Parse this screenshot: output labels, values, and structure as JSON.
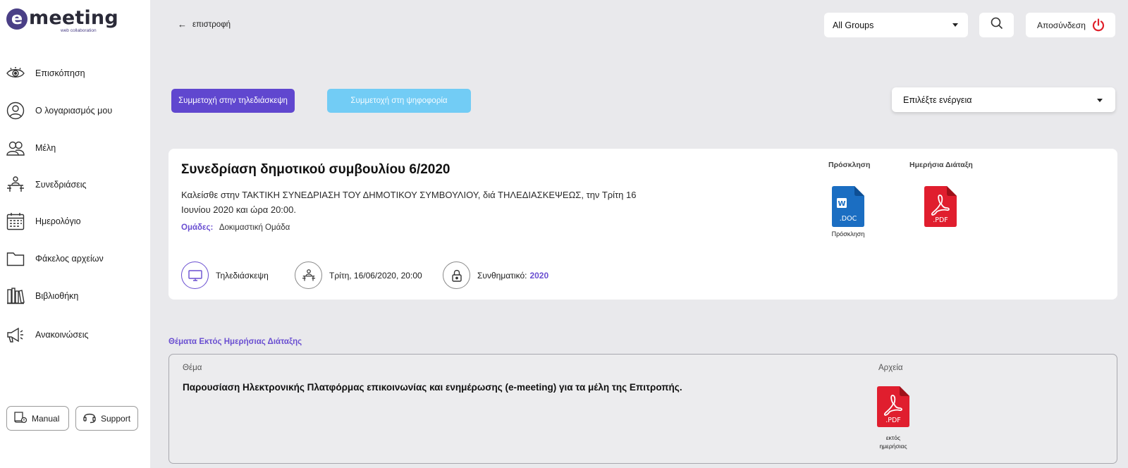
{
  "brand": {
    "name": "meeting",
    "letter": "e",
    "tagline": "web collaboration"
  },
  "sidebar": {
    "items": [
      {
        "label": "Επισκόπηση",
        "icon": "eye-icon"
      },
      {
        "label": "Ο λογαριασμός μου",
        "icon": "user-circle-icon"
      },
      {
        "label": "Μέλη",
        "icon": "users-icon"
      },
      {
        "label": "Συνεδριάσεις",
        "icon": "meeting-table-icon"
      },
      {
        "label": "Ημερολόγιο",
        "icon": "calendar-icon"
      },
      {
        "label": "Φάκελος αρχείων",
        "icon": "folder-icon"
      },
      {
        "label": "Βιβλιοθήκη",
        "icon": "library-icon"
      },
      {
        "label": "Ανακοινώσεις",
        "icon": "megaphone-icon"
      }
    ],
    "manual_label": "Manual",
    "support_label": "Support"
  },
  "header": {
    "back_label": "επιστροφή",
    "groups_value": "All Groups",
    "logout_label": "Αποσύνδεση"
  },
  "actions": {
    "join_conference_label": "Συμμετοχή στην τηλεδιάσκεψη",
    "join_vote_label": "Συμμετοχή στη ψηφοφορία",
    "select_action_placeholder": "Επιλέξτε ενέργεια"
  },
  "meeting": {
    "title": "Συνεδρίαση δημοτικού συμβουλίου 6/2020",
    "description": "Καλείσθε στην ΤΑΚΤΙΚΗ ΣΥΝΕΔΡΙΑΣΗ ΤΟΥ ΔΗΜΟΤΙΚΟΥ ΣΥΜΒΟΥΛΙΟΥ, διά ΤΗΛΕΔΙΑΣΚΕΨΕΩΣ, την Τρίτη 16 Ιουνίου 2020 και ώρα 20:00.",
    "groups_label": "Ομάδες:",
    "groups_value": "Δοκιμαστική Ομάδα",
    "type_label": "Τηλεδιάσκεψη",
    "datetime": "Τρίτη, 16/06/2020, 20:00",
    "password_label": "Συνθηματικό:",
    "password_value": "2020",
    "documents": {
      "invitation_header": "Πρόσκληση",
      "invitation_file_ext": ".DOC",
      "invitation_caption": "Πρόσκληση",
      "agenda_header": "Ημερήσια Διάταξη",
      "agenda_file_ext": ".PDF"
    }
  },
  "off_agenda": {
    "section_title": "Θέματα Εκτός Ημερήσιας Διάταξης",
    "topic_header": "Θέμα",
    "files_header": "Αρχεία",
    "topic_text": "Παρουσίαση Ηλεκτρονικής Πλατφόρμας επικοινωνίας και ενημέρωσης (e-meeting) για τα μέλη της Επιτροπής.",
    "file_ext": ".PDF",
    "file_caption": "εκτός ημερήσιας"
  },
  "colors": {
    "primary": "#6047cf",
    "accent_light_blue": "#72ccf5",
    "brand_dark": "#4a3f86",
    "pdf_red": "#e01e2e",
    "doc_blue": "#1b6ec2",
    "logout_red": "#e0202a"
  }
}
